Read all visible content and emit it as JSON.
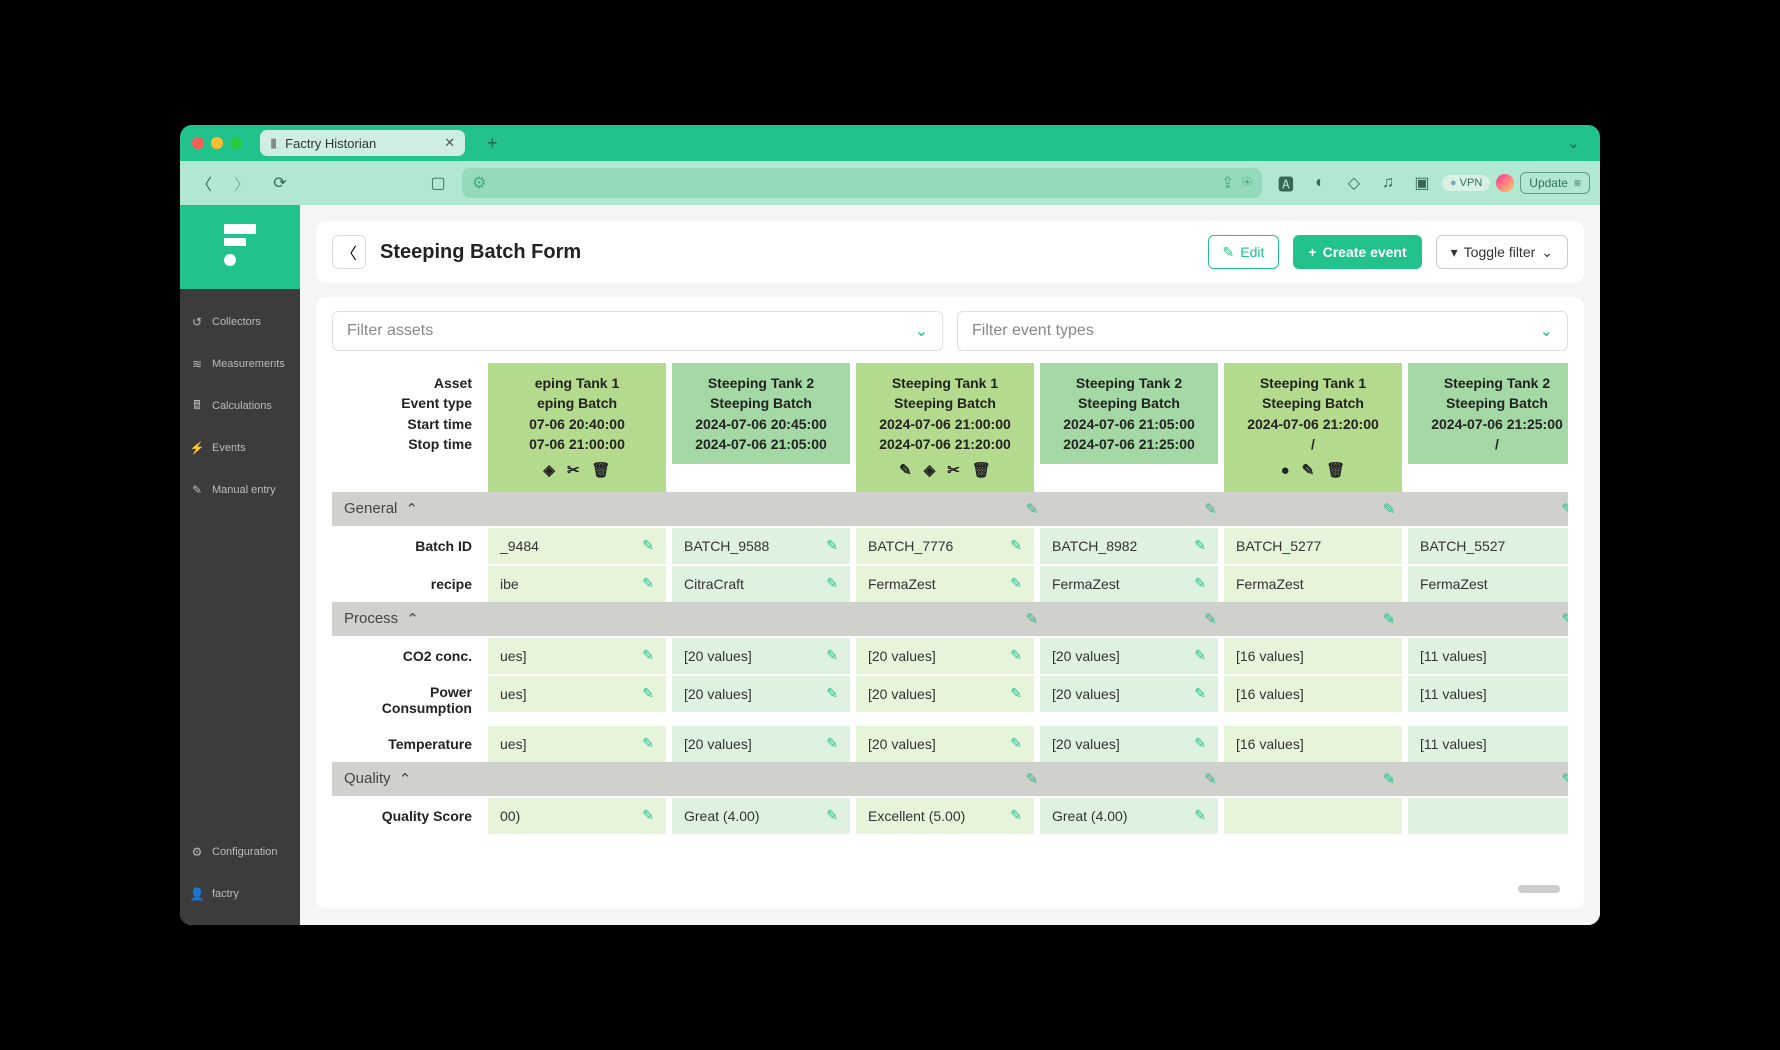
{
  "browser": {
    "tab_title": "Factry Historian",
    "vpn": "VPN",
    "update": "Update"
  },
  "sidebar": {
    "items": [
      {
        "label": "Collectors"
      },
      {
        "label": "Measurements"
      },
      {
        "label": "Calculations"
      },
      {
        "label": "Events"
      },
      {
        "label": "Manual entry"
      }
    ],
    "bottom": [
      {
        "label": "Configuration"
      },
      {
        "label": "factry"
      }
    ]
  },
  "header": {
    "title": "Steeping Batch Form",
    "edit": "Edit",
    "create": "Create event",
    "toggle": "Toggle filter"
  },
  "filters": {
    "assets": "Filter assets",
    "events": "Filter event types"
  },
  "row_headers": {
    "asset": "Asset",
    "event_type": "Event type",
    "start": "Start time",
    "stop": "Stop time"
  },
  "sections": {
    "general": "General",
    "process": "Process",
    "quality": "Quality"
  },
  "fields": {
    "batch_id": "Batch ID",
    "recipe": "recipe",
    "co2": "CO2 conc.",
    "power": "Power Consumption",
    "temp": "Temperature",
    "qscore": "Quality Score"
  },
  "columns": [
    {
      "asset": "eping Tank 1",
      "event_type": "eping Batch",
      "start": "07-06 20:40:00",
      "stop": "07-06 21:00:00",
      "icons": [
        "target",
        "tools",
        "trash"
      ],
      "batch_id": "_9484",
      "recipe": "ibe",
      "co2": "ues]",
      "power": "ues]",
      "temp": "ues]",
      "qscore": "00)",
      "editable": true
    },
    {
      "asset": "Steeping Tank 2",
      "event_type": "Steeping Batch",
      "start": "2024-07-06 20:45:00",
      "stop": "2024-07-06 21:05:00",
      "icons": [],
      "batch_id": "BATCH_9588",
      "recipe": "CitraCraft",
      "co2": "[20 values]",
      "power": "[20 values]",
      "temp": "[20 values]",
      "qscore": "Great (4.00)",
      "editable": true
    },
    {
      "asset": "Steeping Tank 1",
      "event_type": "Steeping Batch",
      "start": "2024-07-06 21:00:00",
      "stop": "2024-07-06 21:20:00",
      "icons": [
        "edit",
        "target",
        "tools",
        "trash"
      ],
      "batch_id": "BATCH_7776",
      "recipe": "FermaZest",
      "co2": "[20 values]",
      "power": "[20 values]",
      "temp": "[20 values]",
      "qscore": "Excellent (5.00)",
      "editable": true
    },
    {
      "asset": "Steeping Tank 2",
      "event_type": "Steeping Batch",
      "start": "2024-07-06 21:05:00",
      "stop": "2024-07-06 21:25:00",
      "icons": [],
      "batch_id": "BATCH_8982",
      "recipe": "FermaZest",
      "co2": "[20 values]",
      "power": "[20 values]",
      "temp": "[20 values]",
      "qscore": "Great (4.00)",
      "editable": true
    },
    {
      "asset": "Steeping Tank 1",
      "event_type": "Steeping Batch",
      "start": "2024-07-06 21:20:00",
      "stop": "/",
      "icons": [
        "record",
        "edit",
        "trash"
      ],
      "batch_id": "BATCH_5277",
      "recipe": "FermaZest",
      "co2": "[16 values]",
      "power": "[16 values]",
      "temp": "[16 values]",
      "qscore": "",
      "editable": false
    },
    {
      "asset": "Steeping Tank 2",
      "event_type": "Steeping Batch",
      "start": "2024-07-06 21:25:00",
      "stop": "/",
      "icons": [],
      "batch_id": "BATCH_5527",
      "recipe": "FermaZest",
      "co2": "[11 values]",
      "power": "[11 values]",
      "temp": "[11 values]",
      "qscore": "",
      "editable": false
    }
  ]
}
